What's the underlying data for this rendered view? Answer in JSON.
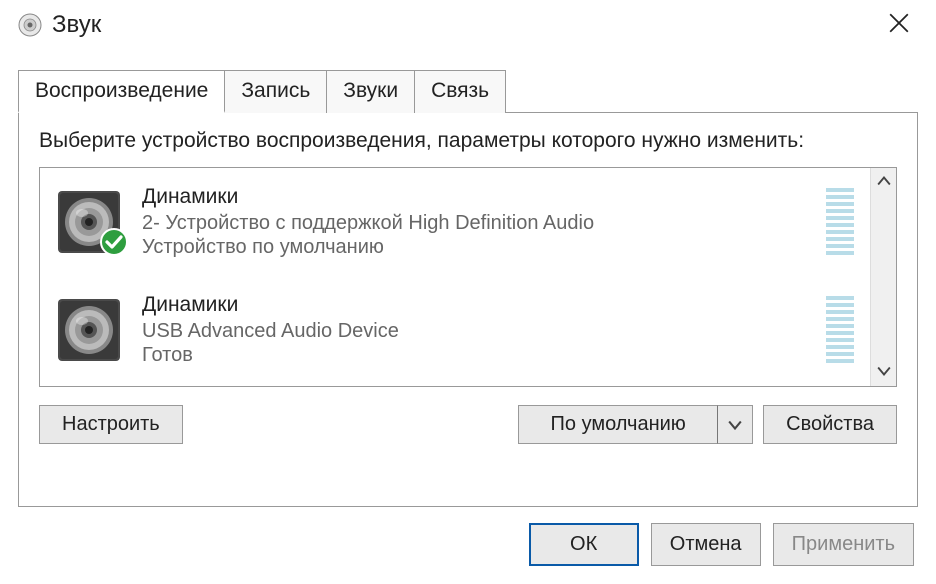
{
  "titlebar": {
    "title": "Звук"
  },
  "tabs": [
    {
      "label": "Воспроизведение",
      "active": true
    },
    {
      "label": "Запись",
      "active": false
    },
    {
      "label": "Звуки",
      "active": false
    },
    {
      "label": "Связь",
      "active": false
    }
  ],
  "instruction": "Выберите устройство воспроизведения, параметры которого нужно изменить:",
  "devices": [
    {
      "name": "Динамики",
      "description": "2- Устройство с поддержкой High Definition Audio",
      "status": "Устройство по умолчанию",
      "is_default": true
    },
    {
      "name": "Динамики",
      "description": "USB Advanced Audio Device",
      "status": "Готов",
      "is_default": false
    }
  ],
  "buttons": {
    "configure": "Настроить",
    "set_default": "По умолчанию",
    "properties": "Свойства",
    "ok": "ОК",
    "cancel": "Отмена",
    "apply": "Применить"
  }
}
